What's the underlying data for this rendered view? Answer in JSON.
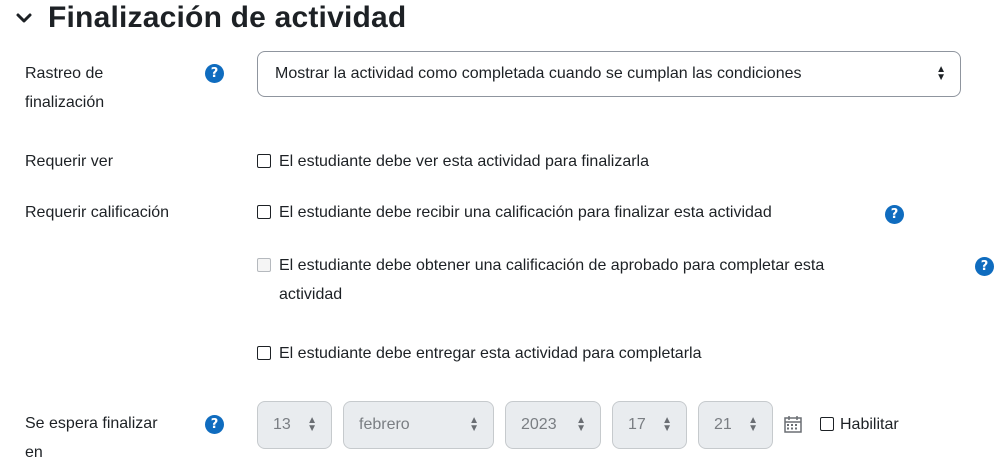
{
  "section": {
    "title": "Finalización de actividad",
    "icon": "chevron-down-icon"
  },
  "tracking": {
    "label_line1": "Rastreo de",
    "label_line2": "finalización",
    "selected": "Mostrar la actividad como completada cuando se cumplan las condiciones"
  },
  "require_view": {
    "label": "Requerir ver",
    "checkbox_label": "El estudiante debe ver esta actividad para finalizarla",
    "checked": false
  },
  "require_grade": {
    "label": "Requerir calificación",
    "receive_grade_label": "El estudiante debe recibir una calificación para finalizar esta actividad",
    "pass_grade_line1": "El estudiante debe obtener una calificación de aprobado para completar esta",
    "pass_grade_line2": "actividad",
    "pass_grade_disabled": true
  },
  "require_submit": {
    "label": "El estudiante debe entregar esta actividad para completarla",
    "checked": false
  },
  "expected": {
    "label_line1": "Se espera finalizar",
    "label_line2": "en",
    "day": "13",
    "month": "febrero",
    "year": "2023",
    "hour": "17",
    "minute": "21",
    "enable_label": "Habilitar"
  },
  "colors": {
    "help_icon": "#0f6cbf",
    "text": "#1d2125",
    "disabled_bg": "#e9ecef"
  }
}
